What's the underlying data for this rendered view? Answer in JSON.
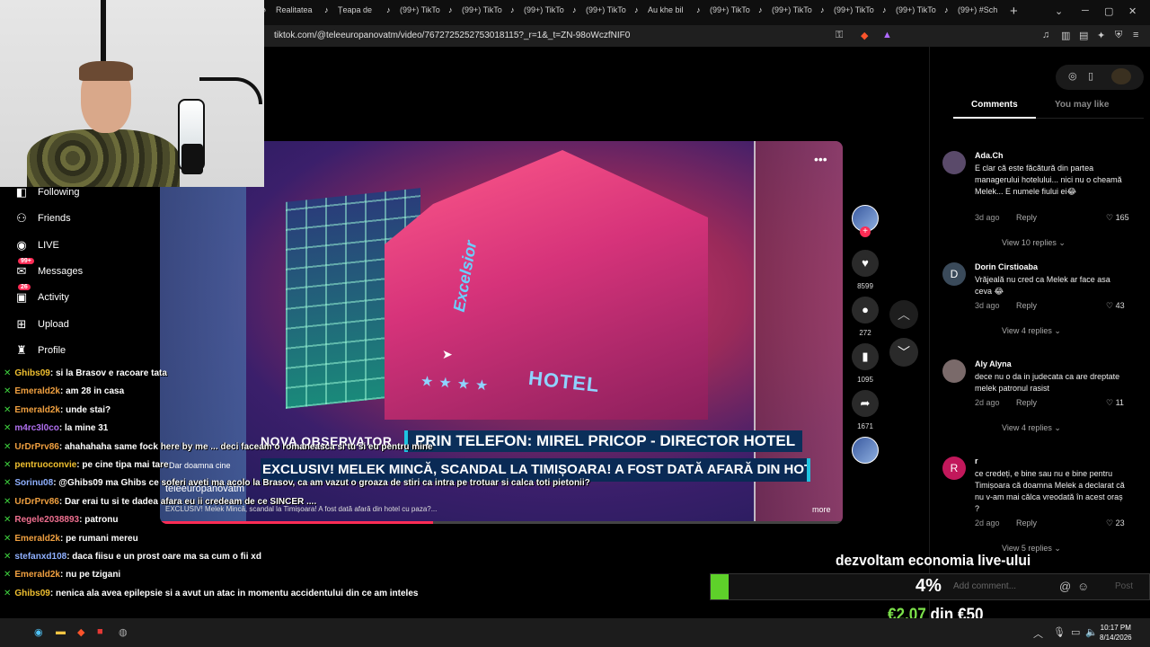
{
  "browser": {
    "tabs": [
      "Realitatea",
      "Țeapa de",
      "(99+) TikTo",
      "(99+) TikTo",
      "(99+) TikTo",
      "(99+) TikTo",
      "Au khe bil",
      "(99+) TikTo",
      "(99+) TikTo",
      "(99+) TikTo",
      "(99+) TikTo",
      "(99+) #Sch"
    ],
    "new_tab": "+",
    "url": "tiktok.com/@teleeuropanovatm/video/7672725252753018115?_r=1&_t=ZN-98oWczfNIF0"
  },
  "sidebar": {
    "items": [
      {
        "label": "Following",
        "icon": "following-icon"
      },
      {
        "label": "Friends",
        "icon": "friends-icon"
      },
      {
        "label": "LIVE",
        "icon": "live-icon"
      },
      {
        "label": "Messages",
        "icon": "messages-icon",
        "badge": "99+"
      },
      {
        "label": "Activity",
        "icon": "activity-icon",
        "badge": "26"
      },
      {
        "label": "Upload",
        "icon": "upload-icon"
      },
      {
        "label": "Profile",
        "icon": "profile-icon"
      }
    ]
  },
  "video": {
    "news_logo": "NOVA OBSERVATOR",
    "news_tag": "PRIN TELEFON: MIREL PRICOP - DIRECTOR HOTEL",
    "headline": "EXCLUSIV! MELEK MINCĂ, SCANDAL LA TIMIȘOARA! A FOST DATĂ AFARĂ DIN HOTEL CU PAZA?",
    "hotel_sign": "HOTEL",
    "hotel_name": "Excelsior",
    "author": "teleeuropanovatm",
    "description": "EXCLUSIV! Melek Mincă, scandal la Timișoara! A fost dată afară din hotel cu paza?...",
    "more": "more",
    "caption_fragment": "Dar doamna cine",
    "progress": 0.4
  },
  "rail": {
    "likes": "8599",
    "comments": "272",
    "saves": "1095",
    "shares": "1671"
  },
  "comments_panel": {
    "tabs": [
      "Comments",
      "You may like"
    ],
    "comments": [
      {
        "user": "Ada.Ch",
        "text": "E clar că este făcătură din partea managerului hotelului... nici nu o cheamă Melek... E numele fiului ei😂",
        "time": "3d ago",
        "reply": "Reply",
        "likes": "165",
        "view": "View 10 replies",
        "avatar": "",
        "color": "#5a4a6a"
      },
      {
        "user": "Dorin Cirstioaba",
        "text": "Vrăjeală nu cred ca Melek ar face asa ceva 😂",
        "time": "3d ago",
        "reply": "Reply",
        "likes": "43",
        "view": "View 4 replies",
        "avatar": "D",
        "color": "#3a4a5a"
      },
      {
        "user": "Aly Alyna",
        "text": "dece nu o da in judecata ca are dreptate melek patronul rasist",
        "time": "2d ago",
        "reply": "Reply",
        "likes": "11",
        "view": "View 4 replies",
        "avatar": "",
        "color": "#7a6a6a"
      },
      {
        "user": "r",
        "text": "ce credeți, e bine sau nu e bine pentru Timișoara că doamna Melek a declarat că nu v-am mai călca vreodată în acest oraș ?",
        "time": "2d ago",
        "reply": "Reply",
        "likes": "23",
        "view": "View 5 replies",
        "avatar": "R",
        "color": "#c2185b"
      }
    ],
    "add_comment_placeholder": "Add comment...",
    "post": "Post"
  },
  "donation": {
    "title": "dezvoltam economia live-ului",
    "percent": "4%",
    "progress": 0.04,
    "raised": "€2.07",
    "goal_text": "din €50"
  },
  "chat": {
    "lines": [
      {
        "user": "Ghibs09",
        "color": "#f0c030",
        "msg": ": si la Brasov e racoare tata"
      },
      {
        "user": "Emerald2k",
        "color": "#f0a040",
        "msg": ": am 28 in casa"
      },
      {
        "user": "Emerald2k",
        "color": "#f0a040",
        "msg": ": unde stai?"
      },
      {
        "user": "m4rc3l0co",
        "color": "#b070f0",
        "msg": ": la mine 31"
      },
      {
        "user": "UrDrPrv86",
        "color": "#f0a040",
        "msg": ": ahahahaha same fock here by me ... deci faceam o romaneasca si tu si eu pentru mine"
      },
      {
        "user": "pentruoconvie",
        "color": "#f0c030",
        "msg": ": pe cine tipa mai tare"
      },
      {
        "user": "Sorinu08",
        "color": "#8fb0ff",
        "msg": ": @Ghibs09 ma Ghibs ce soferi aveti ma acolo la Brasov, ca am vazut o groaza de stiri ca intra pe trotuar si calca toti pietonii?"
      },
      {
        "user": "UrDrPrv86",
        "color": "#f0a040",
        "msg": ": Dar erai tu si te dadea afara eu ii credeam de ce SINCER ...."
      },
      {
        "user": "Regele2038893",
        "color": "#f07090",
        "msg": ": patronu"
      },
      {
        "user": "Emerald2k",
        "color": "#f0a040",
        "msg": ": pe rumani mereu"
      },
      {
        "user": "stefanxd108",
        "color": "#8fb0ff",
        "msg": ": daca fiisu e un prost oare ma sa cum o fii xd"
      },
      {
        "user": "Emerald2k",
        "color": "#f0a040",
        "msg": ": nu pe tzigani"
      },
      {
        "user": "Ghibs09",
        "color": "#f0c030",
        "msg": ": nenica ala avea epilepsie si a avut un atac in momentu accidentului din ce am inteles"
      }
    ]
  },
  "taskbar": {
    "time": "10:17 PM",
    "date": "8/14/2026"
  }
}
